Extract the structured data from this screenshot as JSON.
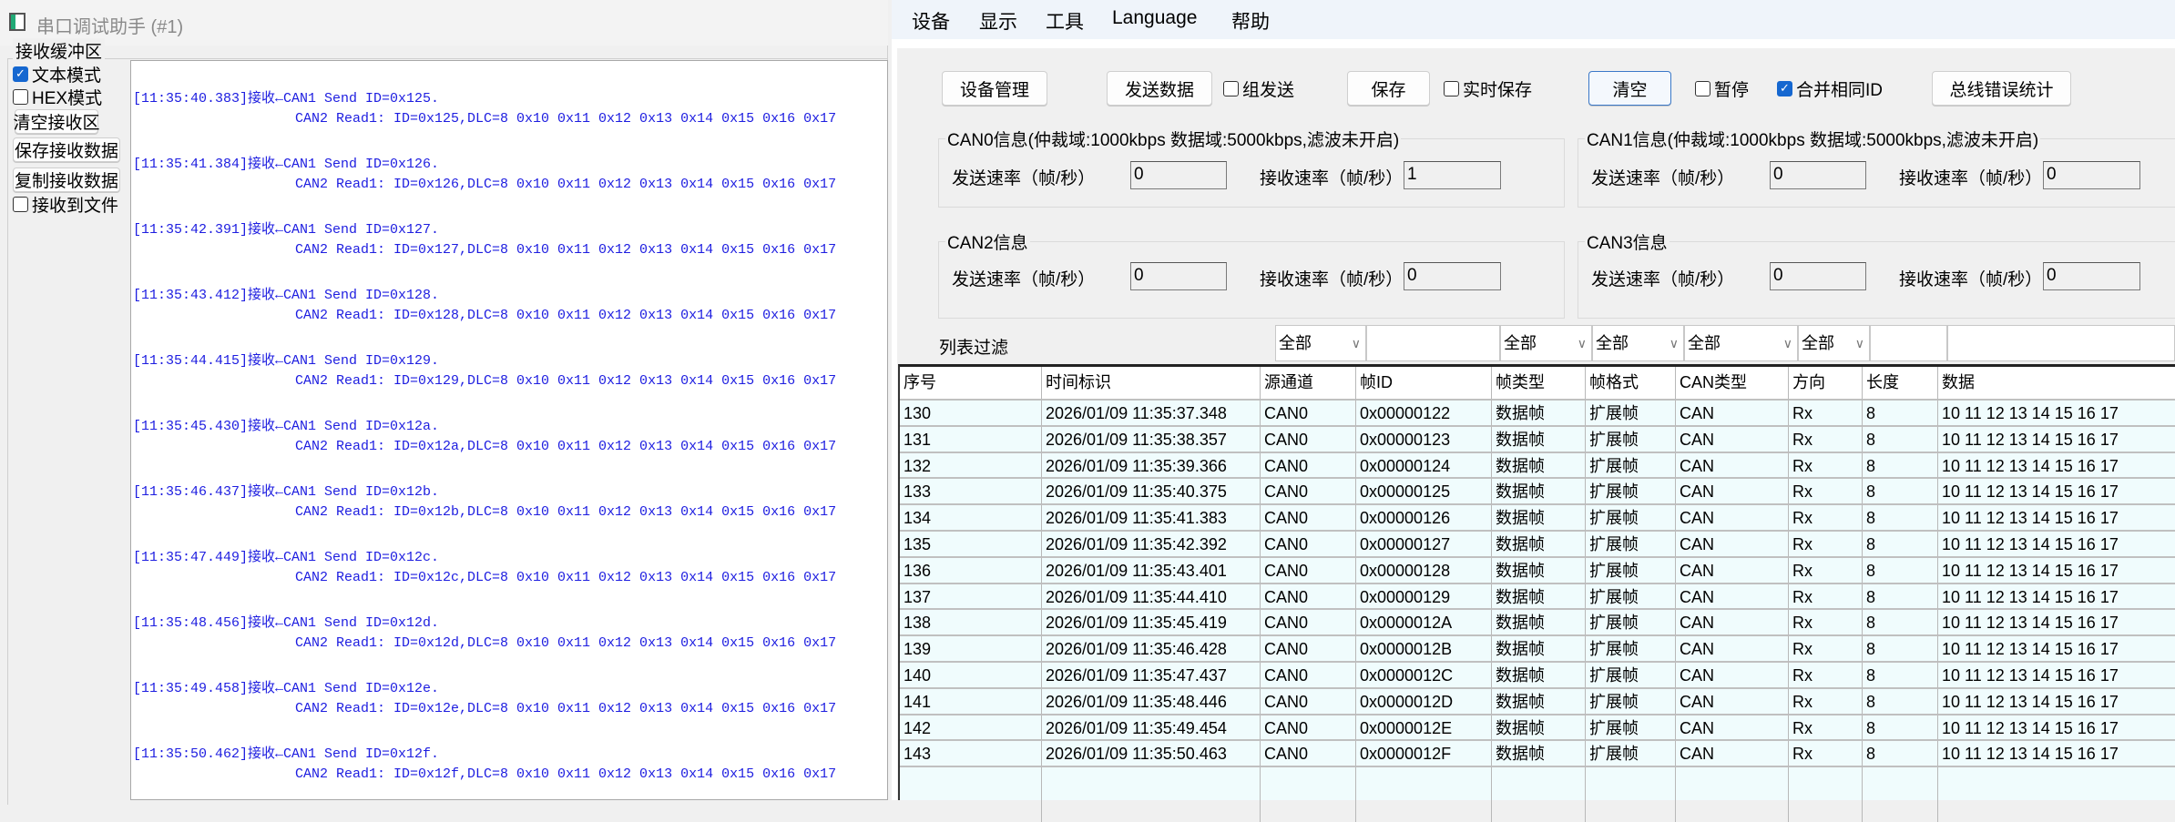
{
  "left": {
    "title": "串口调试助手 (#1)",
    "group_label": "接收缓冲区",
    "text_mode": {
      "label": "文本模式",
      "checked": true
    },
    "hex_mode": {
      "label": "HEX模式",
      "checked": false
    },
    "clear_btn": "清空接收区",
    "save_btn": "保存接收数据",
    "copy_btn": "复制接收数据",
    "to_file": {
      "label": "接收到文件",
      "checked": false
    },
    "log": [
      {
        "a": "[11:35:40.383]接收←CAN1 Send ID=0x125.",
        "b": "CAN2 Read1: ID=0x125,DLC=8 0x10 0x11 0x12 0x13 0x14 0x15 0x16 0x17"
      },
      {
        "a": "[11:35:41.384]接收←CAN1 Send ID=0x126.",
        "b": "CAN2 Read1: ID=0x126,DLC=8 0x10 0x11 0x12 0x13 0x14 0x15 0x16 0x17"
      },
      {
        "a": "[11:35:42.391]接收←CAN1 Send ID=0x127.",
        "b": "CAN2 Read1: ID=0x127,DLC=8 0x10 0x11 0x12 0x13 0x14 0x15 0x16 0x17"
      },
      {
        "a": "[11:35:43.412]接收←CAN1 Send ID=0x128.",
        "b": "CAN2 Read1: ID=0x128,DLC=8 0x10 0x11 0x12 0x13 0x14 0x15 0x16 0x17"
      },
      {
        "a": "[11:35:44.415]接收←CAN1 Send ID=0x129.",
        "b": "CAN2 Read1: ID=0x129,DLC=8 0x10 0x11 0x12 0x13 0x14 0x15 0x16 0x17"
      },
      {
        "a": "[11:35:45.430]接收←CAN1 Send ID=0x12a.",
        "b": "CAN2 Read1: ID=0x12a,DLC=8 0x10 0x11 0x12 0x13 0x14 0x15 0x16 0x17"
      },
      {
        "a": "[11:35:46.437]接收←CAN1 Send ID=0x12b.",
        "b": "CAN2 Read1: ID=0x12b,DLC=8 0x10 0x11 0x12 0x13 0x14 0x15 0x16 0x17"
      },
      {
        "a": "[11:35:47.449]接收←CAN1 Send ID=0x12c.",
        "b": "CAN2 Read1: ID=0x12c,DLC=8 0x10 0x11 0x12 0x13 0x14 0x15 0x16 0x17"
      },
      {
        "a": "[11:35:48.456]接收←CAN1 Send ID=0x12d.",
        "b": "CAN2 Read1: ID=0x12d,DLC=8 0x10 0x11 0x12 0x13 0x14 0x15 0x16 0x17"
      },
      {
        "a": "[11:35:49.458]接收←CAN1 Send ID=0x12e.",
        "b": "CAN2 Read1: ID=0x12e,DLC=8 0x10 0x11 0x12 0x13 0x14 0x15 0x16 0x17"
      },
      {
        "a": "[11:35:50.462]接收←CAN1 Send ID=0x12f.",
        "b": "CAN2 Read1: ID=0x12f,DLC=8 0x10 0x11 0x12 0x13 0x14 0x15 0x16 0x17"
      }
    ]
  },
  "right": {
    "menu": [
      "设备",
      "显示",
      "工具",
      "Language",
      "帮助"
    ],
    "toolbar": {
      "device_mgmt": "设备管理",
      "send_data": "发送数据",
      "group_send": "组发送",
      "save": "保存",
      "realtime_save": "实时保存",
      "clear": "清空",
      "pause": "暂停",
      "merge_id": "合并相同ID",
      "bus_error": "总线错误统计"
    },
    "can_groups": [
      {
        "title": "CAN0信息(仲裁域:1000kbps   数据域:5000kbps,滤波未开启)",
        "tx_label": "发送速率（帧/秒）",
        "tx": "0",
        "rx_label": "接收速率（帧/秒）",
        "rx": "1"
      },
      {
        "title": "CAN1信息(仲裁域:1000kbps   数据域:5000kbps,滤波未开启)",
        "tx_label": "发送速率（帧/秒）",
        "tx": "0",
        "rx_label": "接收速率（帧/秒）",
        "rx": "0"
      },
      {
        "title": "CAN2信息",
        "tx_label": "发送速率（帧/秒）",
        "tx": "0",
        "rx_label": "接收速率（帧/秒）",
        "rx": "0"
      },
      {
        "title": "CAN3信息",
        "tx_label": "发送速率（帧/秒）",
        "tx": "0",
        "rx_label": "接收速率（帧/秒）",
        "rx": "0"
      }
    ],
    "filter": {
      "label": "列表过滤",
      "channel": "全部",
      "frame_type": "全部",
      "frame_format": "全部",
      "can_type": "全部",
      "direction": "全部"
    },
    "columns": [
      "序号",
      "时间标识",
      "源通道",
      "帧ID",
      "帧类型",
      "帧格式",
      "CAN类型",
      "方向",
      "长度",
      "数据"
    ],
    "rows": [
      [
        "130",
        "2026/01/09 11:35:37.348",
        "CAN0",
        "0x00000122",
        "数据帧",
        "扩展帧",
        "CAN",
        "Rx",
        "8",
        "10 11 12 13 14 15 16 17"
      ],
      [
        "131",
        "2026/01/09 11:35:38.357",
        "CAN0",
        "0x00000123",
        "数据帧",
        "扩展帧",
        "CAN",
        "Rx",
        "8",
        "10 11 12 13 14 15 16 17"
      ],
      [
        "132",
        "2026/01/09 11:35:39.366",
        "CAN0",
        "0x00000124",
        "数据帧",
        "扩展帧",
        "CAN",
        "Rx",
        "8",
        "10 11 12 13 14 15 16 17"
      ],
      [
        "133",
        "2026/01/09 11:35:40.375",
        "CAN0",
        "0x00000125",
        "数据帧",
        "扩展帧",
        "CAN",
        "Rx",
        "8",
        "10 11 12 13 14 15 16 17"
      ],
      [
        "134",
        "2026/01/09 11:35:41.383",
        "CAN0",
        "0x00000126",
        "数据帧",
        "扩展帧",
        "CAN",
        "Rx",
        "8",
        "10 11 12 13 14 15 16 17"
      ],
      [
        "135",
        "2026/01/09 11:35:42.392",
        "CAN0",
        "0x00000127",
        "数据帧",
        "扩展帧",
        "CAN",
        "Rx",
        "8",
        "10 11 12 13 14 15 16 17"
      ],
      [
        "136",
        "2026/01/09 11:35:43.401",
        "CAN0",
        "0x00000128",
        "数据帧",
        "扩展帧",
        "CAN",
        "Rx",
        "8",
        "10 11 12 13 14 15 16 17"
      ],
      [
        "137",
        "2026/01/09 11:35:44.410",
        "CAN0",
        "0x00000129",
        "数据帧",
        "扩展帧",
        "CAN",
        "Rx",
        "8",
        "10 11 12 13 14 15 16 17"
      ],
      [
        "138",
        "2026/01/09 11:35:45.419",
        "CAN0",
        "0x0000012A",
        "数据帧",
        "扩展帧",
        "CAN",
        "Rx",
        "8",
        "10 11 12 13 14 15 16 17"
      ],
      [
        "139",
        "2026/01/09 11:35:46.428",
        "CAN0",
        "0x0000012B",
        "数据帧",
        "扩展帧",
        "CAN",
        "Rx",
        "8",
        "10 11 12 13 14 15 16 17"
      ],
      [
        "140",
        "2026/01/09 11:35:47.437",
        "CAN0",
        "0x0000012C",
        "数据帧",
        "扩展帧",
        "CAN",
        "Rx",
        "8",
        "10 11 12 13 14 15 16 17"
      ],
      [
        "141",
        "2026/01/09 11:35:48.446",
        "CAN0",
        "0x0000012D",
        "数据帧",
        "扩展帧",
        "CAN",
        "Rx",
        "8",
        "10 11 12 13 14 15 16 17"
      ],
      [
        "142",
        "2026/01/09 11:35:49.454",
        "CAN0",
        "0x0000012E",
        "数据帧",
        "扩展帧",
        "CAN",
        "Rx",
        "8",
        "10 11 12 13 14 15 16 17"
      ],
      [
        "143",
        "2026/01/09 11:35:50.463",
        "CAN0",
        "0x0000012F",
        "数据帧",
        "扩展帧",
        "CAN",
        "Rx",
        "8",
        "10 11 12 13 14 15 16 17"
      ]
    ],
    "colors": {
      "log_text": "#1d1de0",
      "row_bg": "#f0fcfd",
      "checkbox": "#1567d0"
    }
  }
}
